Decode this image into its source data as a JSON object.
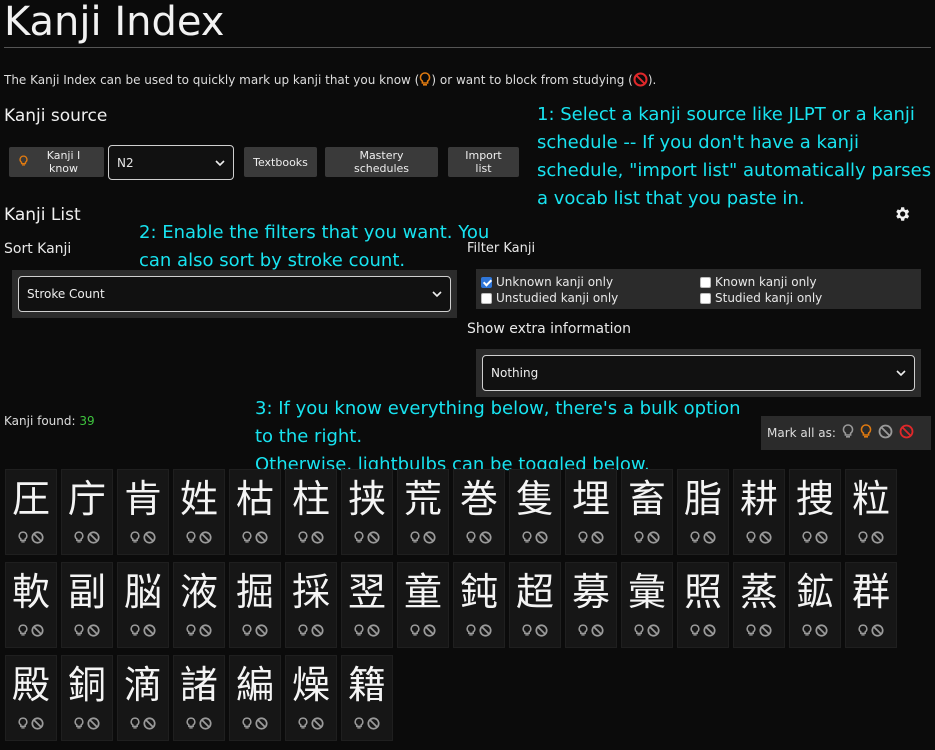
{
  "page": {
    "title": "Kanji Index",
    "intro_pre": "The Kanji Index can be used to quickly mark up kanji that you know (",
    "intro_mid": ") or want to block from studying (",
    "intro_post": ")."
  },
  "source": {
    "heading": "Kanji source",
    "known_button": "Kanji I know",
    "level_select": "N2",
    "buttons": [
      "Textbooks",
      "Mastery schedules",
      "Import list"
    ]
  },
  "annotations": {
    "step1": "1: Select a kanji source like JLPT or a kanji schedule -- If you don't have a kanji schedule, \"import list\" automatically parses a vocab list that you paste in.",
    "step2": "2: Enable the filters that you want. You can also sort by stroke count.",
    "step3a": "3: If you know everything below, there's a bulk option to the right.",
    "step3b": "Otherwise, lightbulbs can be toggled below."
  },
  "list": {
    "heading": "Kanji List",
    "sort_label": "Sort Kanji",
    "sort_value": "Stroke Count",
    "filter_label": "Filter Kanji",
    "filters": [
      {
        "label": "Unknown kanji only",
        "checked": true
      },
      {
        "label": "Known kanji only",
        "checked": false
      },
      {
        "label": "Unstudied kanji only",
        "checked": false
      },
      {
        "label": "Studied kanji only",
        "checked": false
      }
    ],
    "extra_label": "Show extra information",
    "extra_value": "Nothing",
    "found_label": "Kanji found:",
    "found_count": "39",
    "mark_all_label": "Mark all as:"
  },
  "colors": {
    "accent_orange": "#e07a10",
    "annotation_cyan": "#18e3f0",
    "count_green": "#3ec43e",
    "block_red": "#e0282a"
  },
  "kanji": [
    "圧",
    "庁",
    "肯",
    "姓",
    "枯",
    "柱",
    "挟",
    "荒",
    "巻",
    "隻",
    "埋",
    "畜",
    "脂",
    "耕",
    "捜",
    "粒",
    "軟",
    "副",
    "脳",
    "液",
    "掘",
    "採",
    "翌",
    "童",
    "鈍",
    "超",
    "募",
    "彙",
    "照",
    "蒸",
    "鉱",
    "群",
    "殿",
    "銅",
    "滴",
    "諸",
    "編",
    "燥",
    "籍"
  ]
}
